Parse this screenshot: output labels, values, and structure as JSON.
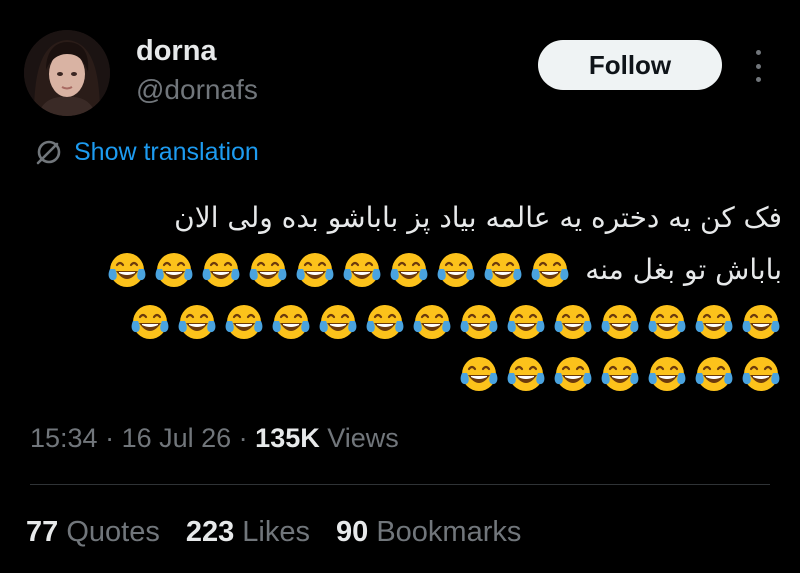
{
  "author": {
    "display_name": "dorna",
    "handle": "@dornafs",
    "avatar_icon": "profile-photo"
  },
  "follow_label": "Follow",
  "more_icon": "more-options-icon",
  "translation": {
    "label": "Show translation",
    "icon": "translate-globe-icon",
    "color": "#1d9bf0"
  },
  "tweet": {
    "line1": "فک کن یه دختره یه عالمه بیاد پز باباشو بده ولی الان",
    "line2": "باباش تو بغل منه",
    "emoji_name": "face-with-tears-of-joy",
    "emoji_rows": [
      10,
      14,
      7
    ]
  },
  "meta": {
    "time": "15:34",
    "sep1": " · ",
    "date": "16 Jul 26",
    "sep2": " · ",
    "views_count": "135K",
    "views_label": "Views"
  },
  "stats": {
    "quotes_count": "77",
    "quotes_label": "Quotes",
    "likes_count": "223",
    "likes_label": "Likes",
    "bookmarks_count": "90",
    "bookmarks_label": "Bookmarks"
  },
  "colors": {
    "background": "#000000",
    "primary_text": "#e7e9ea",
    "secondary_text": "#71767b",
    "follow_bg": "#eff3f4",
    "emoji_yellow": "#fcc21b"
  }
}
